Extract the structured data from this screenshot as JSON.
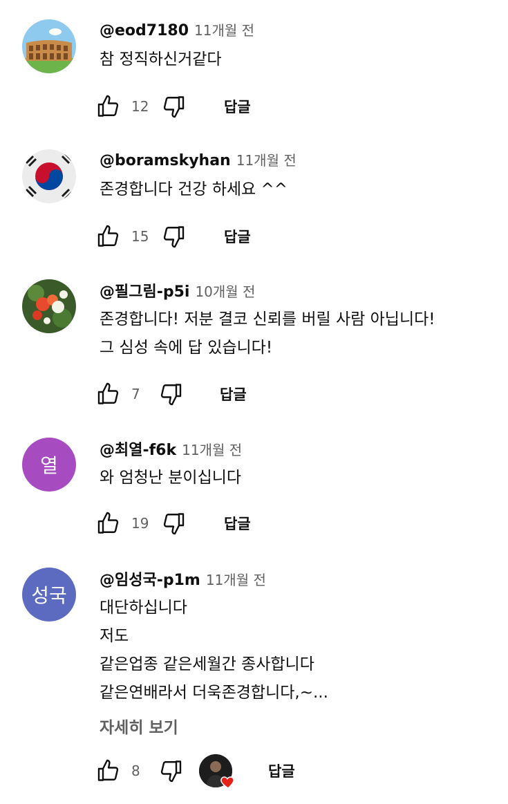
{
  "comments": [
    {
      "author": "@eod7180",
      "time": "11개월 전",
      "text": [
        "참 정직하신거같다"
      ],
      "likes": "12",
      "reply_label": "답글",
      "avatar_type": "colosseum-image"
    },
    {
      "author": "@boramskyhan",
      "time": "11개월 전",
      "text": [
        "존경합니다 건강 하세요 ^^"
      ],
      "likes": "15",
      "reply_label": "답글",
      "avatar_type": "korean-flag-image"
    },
    {
      "author": "@필그림-p5i",
      "time": "10개월 전",
      "text": [
        "존경합니다! 저분 결코 신뢰를 버릴 사람 아닙니다!",
        "그 심성 속에 답 있습니다!"
      ],
      "likes": "7",
      "reply_label": "답글",
      "avatar_type": "flower-image"
    },
    {
      "author": "@최열-f6k",
      "time": "11개월 전",
      "text": [
        "와 엄청난 분이십니다"
      ],
      "likes": "19",
      "reply_label": "답글",
      "avatar_letter": "열",
      "avatar_color": "#a74bc0"
    },
    {
      "author": "@임성국-p1m",
      "time": "11개월 전",
      "text": [
        "대단하십니다",
        "저도",
        "같은업종 같은세월간 종사합니다",
        "같은연배라서 더욱존경합니다,~..."
      ],
      "read_more": "자세히 보기",
      "likes": "8",
      "reply_label": "답글",
      "avatar_letter": "성국",
      "avatar_color": "#5c6bc0",
      "creator_heart": true
    }
  ],
  "icons": {
    "like": "thumbs-up-icon",
    "dislike": "thumbs-down-icon",
    "heart": "heart-icon"
  },
  "colors": {
    "heart": "#e62117",
    "meta_gray": "#606060"
  }
}
